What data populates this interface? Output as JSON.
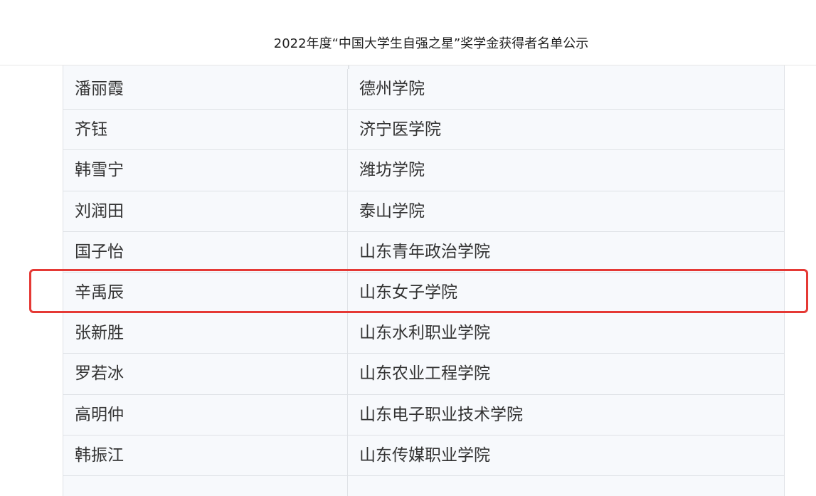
{
  "page": {
    "title": "2022年度“中国大学生自强之星”奖学金获得者名单公示"
  },
  "table": {
    "rows": [
      {
        "name": "潘丽霞",
        "school": "德州学院"
      },
      {
        "name": "齐钰",
        "school": "济宁医学院"
      },
      {
        "name": "韩雪宁",
        "school": "潍坊学院"
      },
      {
        "name": "刘润田",
        "school": "泰山学院"
      },
      {
        "name": "国子怡",
        "school": "山东青年政治学院"
      },
      {
        "name": "辛禹辰",
        "school": "山东女子学院"
      },
      {
        "name": "张新胜",
        "school": "山东水利职业学院"
      },
      {
        "name": "罗若冰",
        "school": "山东农业工程学院"
      },
      {
        "name": "高明仲",
        "school": "山东电子职业技术学院"
      },
      {
        "name": "韩振江",
        "school": "山东传媒职业学院"
      },
      {
        "name": "",
        "school": ""
      }
    ]
  },
  "annotation": {
    "highlight_color": "#e53935",
    "highlighted_row_index": 5
  }
}
